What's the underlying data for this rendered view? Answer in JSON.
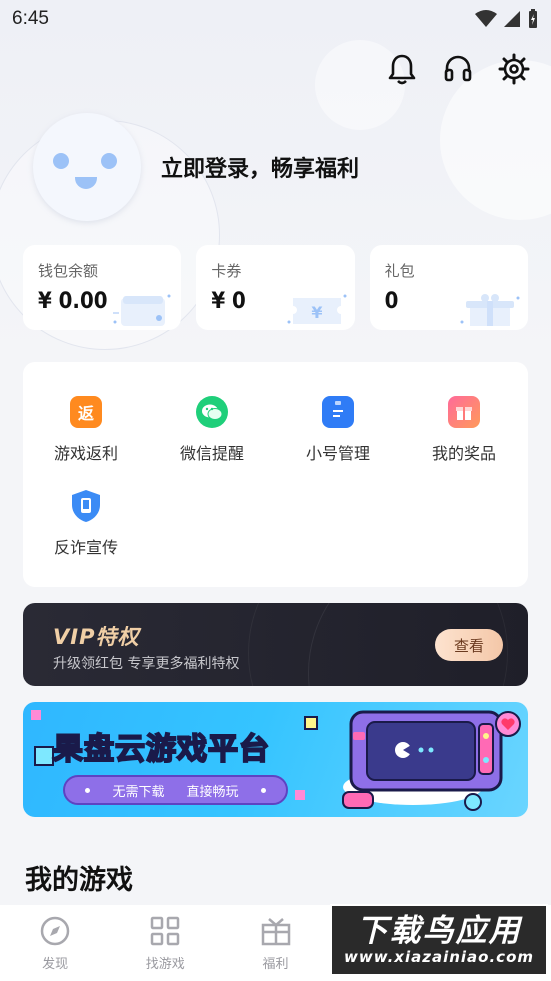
{
  "status_bar": {
    "time": "6:45"
  },
  "top_icons": [
    "bell-icon",
    "headset-icon",
    "settings-icon"
  ],
  "profile": {
    "login_text": "立即登录，畅享福利"
  },
  "wallet": [
    {
      "label": "钱包余额",
      "value": "¥ 0.00"
    },
    {
      "label": "卡券",
      "value": "¥ 0"
    },
    {
      "label": "礼包",
      "value": "0"
    }
  ],
  "features": [
    {
      "label": "游戏返利",
      "icon_text": "返",
      "color": "#ff8a1f"
    },
    {
      "label": "微信提醒",
      "icon_text": "",
      "color": "#1fcf7a"
    },
    {
      "label": "小号管理",
      "icon_text": "",
      "color": "#2f7cf6"
    },
    {
      "label": "我的奖品",
      "icon_text": "",
      "color": "#ff6a6a"
    },
    {
      "label": "反诈宣传",
      "icon_text": "",
      "color": "#3b8bf5"
    }
  ],
  "vip": {
    "title": "VIP特权",
    "subtitle": "升级领红包 专享更多福利特权",
    "button": "查看"
  },
  "banner": {
    "title": "果盘云游戏平台",
    "pill_text_1": "无需下载",
    "pill_text_2": "直接畅玩"
  },
  "section": {
    "title": "我的游戏"
  },
  "tabs": [
    {
      "label": "发现",
      "icon": "compass-icon"
    },
    {
      "label": "找游戏",
      "icon": "grid-icon"
    },
    {
      "label": "福利",
      "icon": "gift-icon"
    },
    {
      "label": "",
      "icon": "message-icon"
    },
    {
      "label": "",
      "icon": "user-icon"
    }
  ],
  "watermark": {
    "big": "下载鸟应用",
    "small": "www.xiazainiao.com"
  }
}
